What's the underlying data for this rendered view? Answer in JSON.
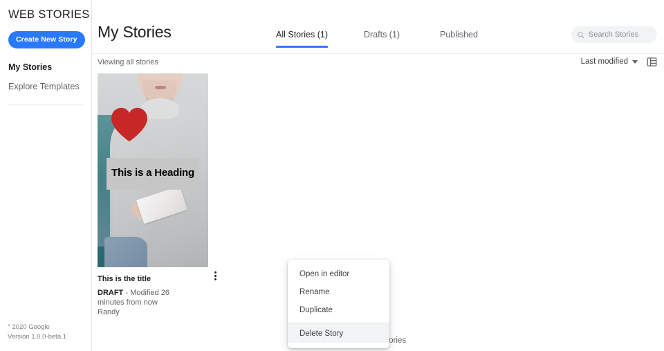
{
  "sidebar": {
    "brand": "WEB STORIES",
    "create_button": "Create New Story",
    "nav": [
      {
        "label": "My Stories",
        "name": "my-stories"
      },
      {
        "label": "Explore Templates",
        "name": "explore-templates"
      }
    ],
    "footer": {
      "copyright": "° 2020 Google",
      "version": "Version 1.0.0-beta.1"
    }
  },
  "header": {
    "title": "My Stories",
    "tabs": [
      {
        "label": "All Stories (1)",
        "active": true
      },
      {
        "label": "Drafts (1)",
        "active": false
      },
      {
        "label": "Published",
        "active": false
      }
    ],
    "search": {
      "placeholder": "Search Stories",
      "value": "",
      "icon": "search-icon"
    }
  },
  "subheader": {
    "viewing_label": "Viewing all stories",
    "sort_label": "Last modified",
    "sort_icon": "chevron-down-icon",
    "view_toggle_icon": "grid-view-icon"
  },
  "story_card": {
    "thumbnail": {
      "heading_overlay": "This is a Heading",
      "sticker_icon": "heart-icon"
    },
    "title": "This is the title",
    "status": "DRAFT",
    "status_separator": " - ",
    "modified": "Modified 26 minutes from now",
    "author": "Randy",
    "more_options_icon": "more-vertical-icon"
  },
  "context_menu": {
    "items": [
      {
        "label": "Open in editor",
        "highlighted": false,
        "divider_above": false
      },
      {
        "label": "Rename",
        "highlighted": false,
        "divider_above": false
      },
      {
        "label": "Duplicate",
        "highlighted": false,
        "divider_above": false
      },
      {
        "label": "Delete Story",
        "highlighted": true,
        "divider_above": true
      }
    ]
  },
  "footer": {
    "no_more_stories": "No more stories"
  },
  "colors": {
    "accent_blue": "#2979ff",
    "heart_red": "#c62828",
    "text_primary": "#202124",
    "text_secondary": "#5f6368",
    "search_bg": "#f1f3f4",
    "heading_overlay_bg": "#c6c6c6"
  }
}
